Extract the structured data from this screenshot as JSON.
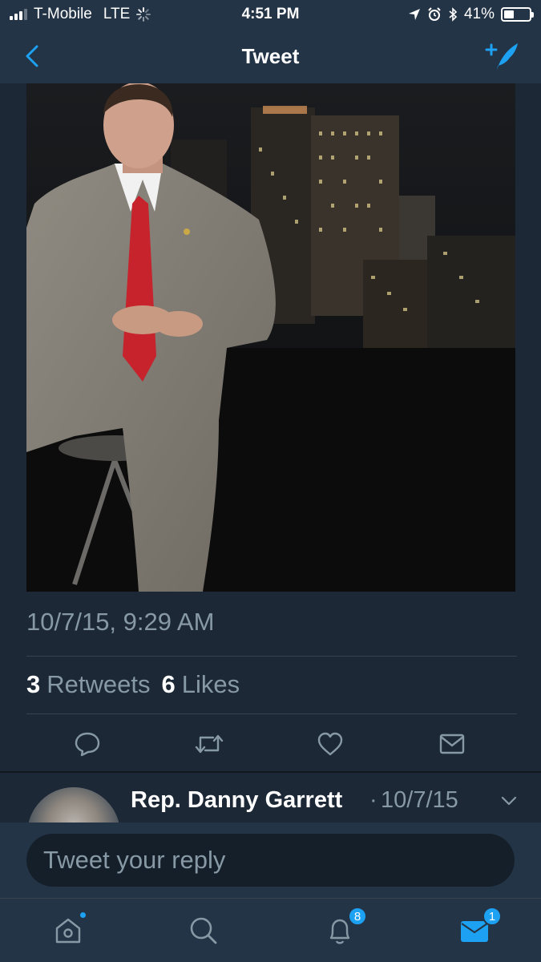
{
  "status_bar": {
    "carrier": "T-Mobile",
    "network": "LTE",
    "time": "4:51 PM",
    "battery": "41%",
    "battery_level": 0.41
  },
  "nav": {
    "title": "Tweet",
    "back_icon": "chevron-left-icon",
    "compose_icon": "compose-feather-icon"
  },
  "tweet": {
    "timestamp": "10/7/15, 9:29 AM",
    "retweets_count": "3",
    "retweets_label": "Retweets",
    "likes_count": "6",
    "likes_label": "Likes",
    "actions": [
      "reply-icon",
      "retweet-icon",
      "like-icon",
      "direct-message-icon"
    ]
  },
  "reply_preview": {
    "name": "Rep. Danny Garrett",
    "separator": "·",
    "date": "10/7/15"
  },
  "composer": {
    "placeholder": "Tweet your reply"
  },
  "tab_bar": {
    "tabs": [
      {
        "icon": "home-icon",
        "has_dot": true
      },
      {
        "icon": "search-icon"
      },
      {
        "icon": "notifications-icon",
        "badge": "8"
      },
      {
        "icon": "messages-icon",
        "badge": "1",
        "active": true
      }
    ]
  },
  "colors": {
    "background": "#1c2836",
    "bar": "#243447",
    "accent": "#1da1f2",
    "muted_text": "#8899a6"
  }
}
